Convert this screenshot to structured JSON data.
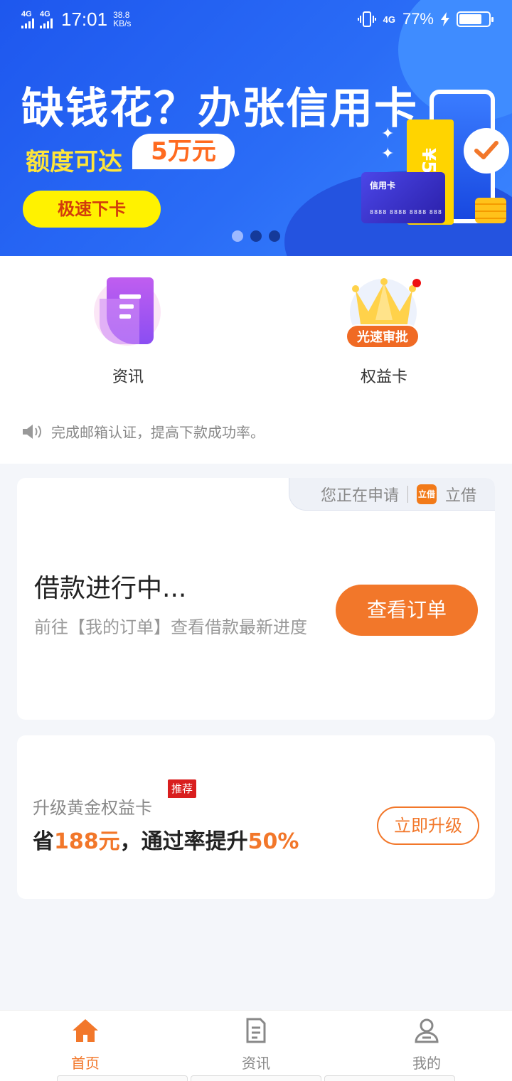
{
  "status_bar": {
    "sim1": "4G",
    "sim2": "4G",
    "time": "17:01",
    "speed_value": "38.8",
    "speed_unit": "KB/s",
    "net_right": "4G",
    "battery_percent": "77%",
    "battery_level": 0.77
  },
  "banner": {
    "headline": "缺钱花？办张信用卡",
    "limit_label": "额度可达",
    "amount": "5万元",
    "cta": "极速下卡",
    "coupon_text": "¥5万",
    "card_title": "信用卡",
    "card_number": "8888 8888 8888 888",
    "slides": 3,
    "active_slide": 1
  },
  "quick_entries": [
    {
      "label": "资讯",
      "icon": "news-document-icon"
    },
    {
      "label": "权益卡",
      "icon": "crown-icon",
      "badge": "光速审批"
    }
  ],
  "notice": {
    "text": "完成邮箱认证，提高下款成功率。",
    "icon": "speaker-icon"
  },
  "loan_card": {
    "applying_label": "您正在申请",
    "product_logo": "立借",
    "product_name": "立借",
    "title": "借款进行中...",
    "description": "前往【我的订单】查看借款最新进度",
    "button": "查看订单"
  },
  "upgrade_card": {
    "label": "升级黄金权益卡",
    "tag": "推荐",
    "save_prefix": "省",
    "save_amount": "188元",
    "middle": "，通过率提升",
    "rate": "50%",
    "button": "立即升级"
  },
  "tab_bar": [
    {
      "label": "首页",
      "icon": "home-icon",
      "active": true
    },
    {
      "label": "资讯",
      "icon": "news-icon",
      "active": false
    },
    {
      "label": "我的",
      "icon": "user-icon",
      "active": false
    }
  ],
  "colors": {
    "accent": "#f2772a",
    "banner_blue": "#2a6cf6",
    "yellow": "#fff200"
  }
}
